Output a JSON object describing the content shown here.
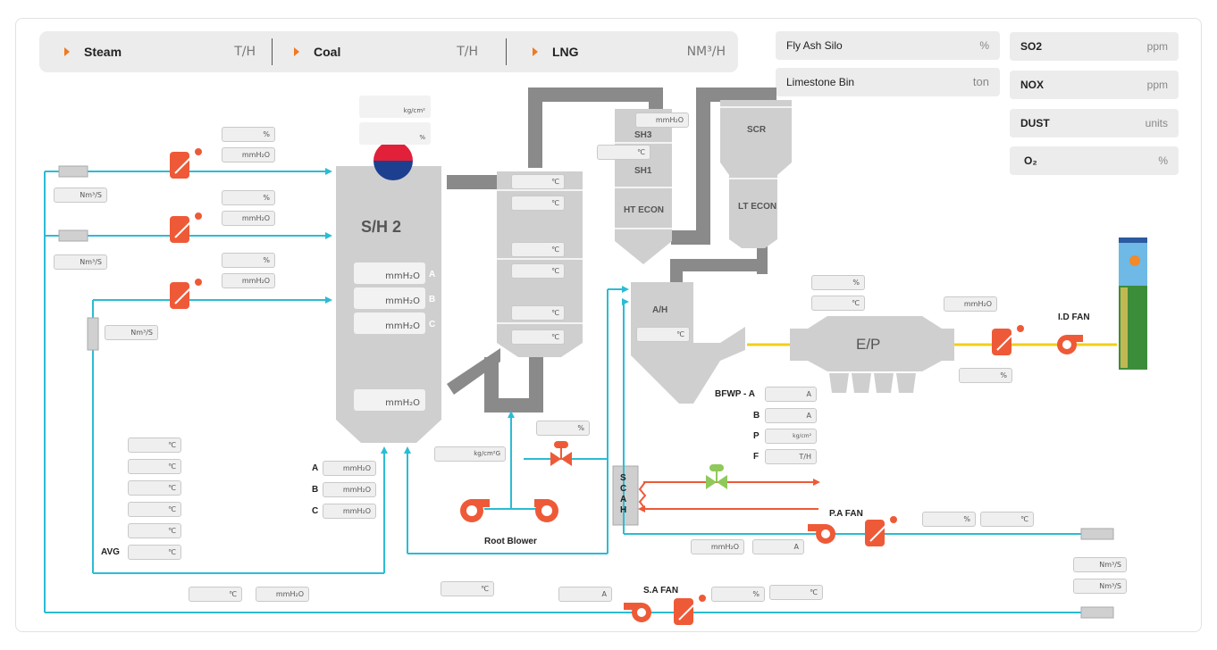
{
  "topbar": {
    "items": [
      {
        "name": "Steam",
        "unit": "T/H"
      },
      {
        "name": "Coal",
        "unit": "T/H"
      },
      {
        "name": "LNG",
        "unit": "NM³/H"
      }
    ]
  },
  "silo": {
    "fly_ash": {
      "name": "Fly Ash Silo",
      "unit": "%"
    },
    "limestone": {
      "name": "Limestone Bin",
      "unit": "ton"
    }
  },
  "emissions": [
    {
      "name": "SO2",
      "unit": "ppm"
    },
    {
      "name": "NOX",
      "unit": "ppm"
    },
    {
      "name": "DUST",
      "unit": "units"
    },
    {
      "name": "O₂",
      "unit": "%"
    }
  ],
  "equipment": {
    "boiler": "S/H 2",
    "sh3": "SH3",
    "sh1": "SH1",
    "ht_econ": "HT ECON",
    "scr": "SCR",
    "lt_econ": "LT ECON",
    "ah": "A/H",
    "ep": "E/P",
    "id_fan": "I.D FAN",
    "pa_fan": "P.A FAN",
    "sa_fan": "S.A FAN",
    "root_blower": "Root Blower",
    "scah": [
      "S",
      "C",
      "A",
      "H"
    ]
  },
  "boiler_letters": [
    "A",
    "B",
    "C"
  ],
  "bfwp": {
    "title": "BFWP - A",
    "rows": [
      "B",
      "P",
      "F"
    ]
  },
  "abc": [
    "A",
    "B",
    "C"
  ],
  "avg": "AVG",
  "units": {
    "kgcm2": "kg/cm²",
    "pct": "%",
    "mmh2o": "mmH₂O",
    "nm3s": "Nm³/S",
    "degc": "℃",
    "amp": "A",
    "th": "T/H",
    "kgcm2g": "kg/cm²G",
    "mmh2o_big": "mmH₂O"
  }
}
